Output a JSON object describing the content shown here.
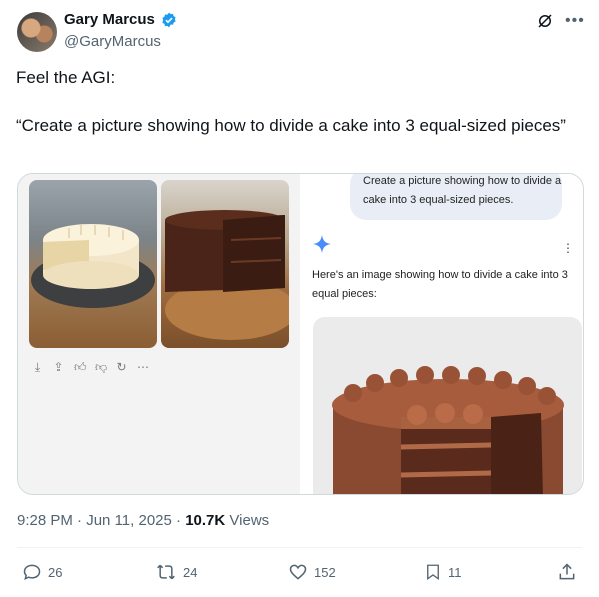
{
  "author": {
    "name": "Gary Marcus",
    "handle": "@GaryMarcus"
  },
  "tweet": {
    "line1": "Feel the AGI:",
    "line2": "“Create a picture showing how to divide a cake into 3 equal-sized pieces”"
  },
  "gemini": {
    "prompt": "Create a picture showing how to divide a cake into 3 equal-sized pieces.",
    "response": "Here's an image showing how to divide a cake into 3 equal pieces:"
  },
  "meta": {
    "time": "9:28 PM",
    "date": "Jun 11, 2025",
    "views_count": "10.7K",
    "views_label": "Views"
  },
  "stats": {
    "replies": "26",
    "reposts": "24",
    "likes": "152",
    "bookmarks": "11"
  },
  "colors": {
    "text": "#0f1419",
    "secondary": "#536471",
    "verified": "#1d9bf0",
    "gemini_bubble": "#e9eef6"
  },
  "icons": [
    "verified-badge-icon",
    "grok-icon",
    "more-icon",
    "download-icon",
    "share-icon",
    "thumbs-up-icon",
    "thumbs-down-icon",
    "regenerate-icon",
    "gemini-sparkle-icon",
    "reply-icon",
    "repost-icon",
    "like-icon",
    "bookmark-icon",
    "share-icon"
  ]
}
